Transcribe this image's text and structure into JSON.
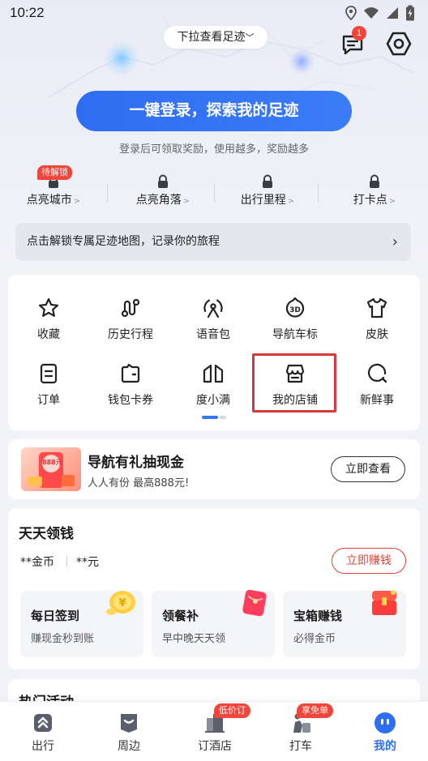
{
  "status_bar": {
    "time": "10:22"
  },
  "header": {
    "pull_hint": "下拉查看足迹",
    "message_badge": "1"
  },
  "login": {
    "button_label": "一键登录，探索我的足迹",
    "hint": "登录后可领取奖励，使用越多，奖励越多"
  },
  "stats": {
    "badge": "待解锁",
    "items": [
      {
        "label": "点亮城市"
      },
      {
        "label": "点亮角落"
      },
      {
        "label": "出行里程"
      },
      {
        "label": "打卡点"
      }
    ]
  },
  "unlock_banner": {
    "text": "点击解锁专属足迹地图，记录你的旅程"
  },
  "functions": {
    "items": [
      {
        "label": "收藏",
        "icon": "star-icon"
      },
      {
        "label": "历史行程",
        "icon": "route-icon"
      },
      {
        "label": "语音包",
        "icon": "voice-pack-icon"
      },
      {
        "label": "导航车标",
        "icon": "car-logo-3d-icon"
      },
      {
        "label": "皮肤",
        "icon": "shirt-icon"
      },
      {
        "label": "订单",
        "icon": "order-icon"
      },
      {
        "label": "钱包卡券",
        "icon": "wallet-icon"
      },
      {
        "label": "度小满",
        "icon": "duxiaoman-icon"
      },
      {
        "label": "我的店铺",
        "icon": "shop-icon"
      },
      {
        "label": "新鲜事",
        "icon": "news-icon"
      }
    ]
  },
  "promo": {
    "title": "导航有礼抽现金",
    "subtitle": "人人有份 最高888元!",
    "button": "立即查看",
    "image_text": "888元"
  },
  "earn": {
    "title": "天天领钱",
    "coins": "**金币",
    "cash": "**元",
    "button": "立即赚钱",
    "tasks": [
      {
        "title": "每日签到",
        "subtitle": "赚现金秒到账"
      },
      {
        "title": "领餐补",
        "subtitle": "早中晚天天领"
      },
      {
        "title": "宝箱赚钱",
        "subtitle": "必得金币"
      }
    ]
  },
  "hot": {
    "title": "热门活动"
  },
  "bottom_nav": {
    "items": [
      {
        "label": "出行",
        "icon": "travel-icon"
      },
      {
        "label": "周边",
        "icon": "nearby-icon"
      },
      {
        "label": "订酒店",
        "icon": "hotel-icon",
        "badge": "低价订"
      },
      {
        "label": "打车",
        "icon": "taxi-icon",
        "badge": "享免单"
      },
      {
        "label": "我的",
        "icon": "profile-icon"
      }
    ],
    "active": "我的"
  },
  "colors": {
    "accent": "#2f6df2",
    "badge": "#f0453a",
    "highlight": "#d9383b"
  }
}
